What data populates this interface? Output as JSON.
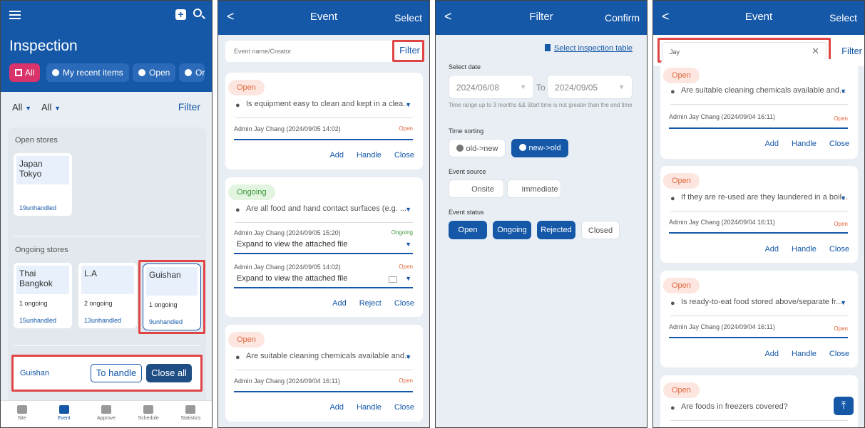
{
  "p1": {
    "title": "Inspection",
    "chips": [
      "All",
      "My recent items",
      "Open",
      "Or"
    ],
    "filters": [
      "All",
      "All"
    ],
    "filter_label": "Filter",
    "open_stores_label": "Open stores",
    "open_stores": [
      {
        "name": "Japan Tokyo",
        "unhandled": "19unhandled"
      }
    ],
    "ongoing_stores_label": "Ongoing stores",
    "ongoing_stores": [
      {
        "name": "Thai Bangkok",
        "ongoing": "1 ongoing",
        "unhandled": "15unhandled"
      },
      {
        "name": "L.A",
        "ongoing": "2 ongoing",
        "unhandled": "13unhandled"
      },
      {
        "name": "Guishan",
        "ongoing": "1 ongoing",
        "unhandled": "9unhandled"
      }
    ],
    "bottom_store": "Guishan",
    "to_handle": "To handle",
    "close_all": "Close all",
    "nav": [
      "Site",
      "Event",
      "Approve",
      "Schedule",
      "Statistics"
    ]
  },
  "p2": {
    "back": "<",
    "title": "Event",
    "action": "Select",
    "search_placeholder": "Event name/Creator",
    "filter": "Filter",
    "cards": [
      {
        "status": "Open",
        "question": "Is equipment easy to clean and kept in a clea...",
        "meta": "Admin Jay Chang (2024/09/05 14:02)",
        "meta_status": "Open",
        "actions": [
          "Add",
          "Handle",
          "Close"
        ]
      },
      {
        "status": "Ongoing",
        "question": "Are all food and hand contact surfaces (e.g. ...",
        "meta1": "Admin Jay Chang (2024/09/05 15:20)",
        "meta1_status": "Ongoing",
        "expand1": "Expand to view the attached file",
        "meta2": "Admin Jay Chang (2024/09/05 14:02)",
        "meta2_status": "Open",
        "expand2": "Expand to view the attached file",
        "actions": [
          "Add",
          "Reject",
          "Close"
        ]
      },
      {
        "status": "Open",
        "question": "Are suitable cleaning chemicals available and...",
        "meta": "Admin Jay Chang (2024/09/04 16:11)",
        "meta_status": "Open",
        "actions": [
          "Add",
          "Handle",
          "Close"
        ]
      }
    ]
  },
  "p3": {
    "back": "<",
    "title": "Filter",
    "action": "Confirm",
    "select_table": "Select inspection table",
    "select_date_label": "Select date",
    "date_from": "2024/06/08",
    "to": "To",
    "date_to": "2024/09/05",
    "date_hint": "Time range up to 3 months && Start time is not greater than the end time",
    "time_sorting_label": "Time sorting",
    "sort_options": [
      "old->new",
      "new->old"
    ],
    "event_source_label": "Event source",
    "source_options": [
      "Onsite",
      "Immediate"
    ],
    "event_status_label": "Event status",
    "status_options": [
      "Open",
      "Ongoing",
      "Rejected",
      "Closed"
    ]
  },
  "p4": {
    "back": "<",
    "title": "Event",
    "action": "Select",
    "search_value": "Jay",
    "filter": "Filter",
    "cards": [
      {
        "status": "Open",
        "question": "Are suitable cleaning chemicals available and...",
        "meta": "Admin Jay Chang (2024/09/04 16:11)",
        "meta_status": "Open",
        "actions": [
          "Add",
          "Handle",
          "Close"
        ]
      },
      {
        "status": "Open",
        "question": "If they are re-used are they laundered in a boil...",
        "meta": "Admin Jay Chang (2024/09/04 16:11)",
        "meta_status": "Open",
        "actions": [
          "Add",
          "Handle",
          "Close"
        ]
      },
      {
        "status": "Open",
        "question": "Is ready-to-eat food stored above/separate fr...",
        "meta": "Admin Jay Chang (2024/09/04 16:11)",
        "meta_status": "Open",
        "actions": [
          "Add",
          "Handle",
          "Close"
        ]
      },
      {
        "status": "Open",
        "question": "Are foods in freezers covered?"
      }
    ]
  },
  "colors": {
    "primary": "#1558a8",
    "accent_pink": "#d8336b",
    "open": "#e2683c",
    "ongoing": "#3a9a3a",
    "highlight": "#e04545"
  }
}
